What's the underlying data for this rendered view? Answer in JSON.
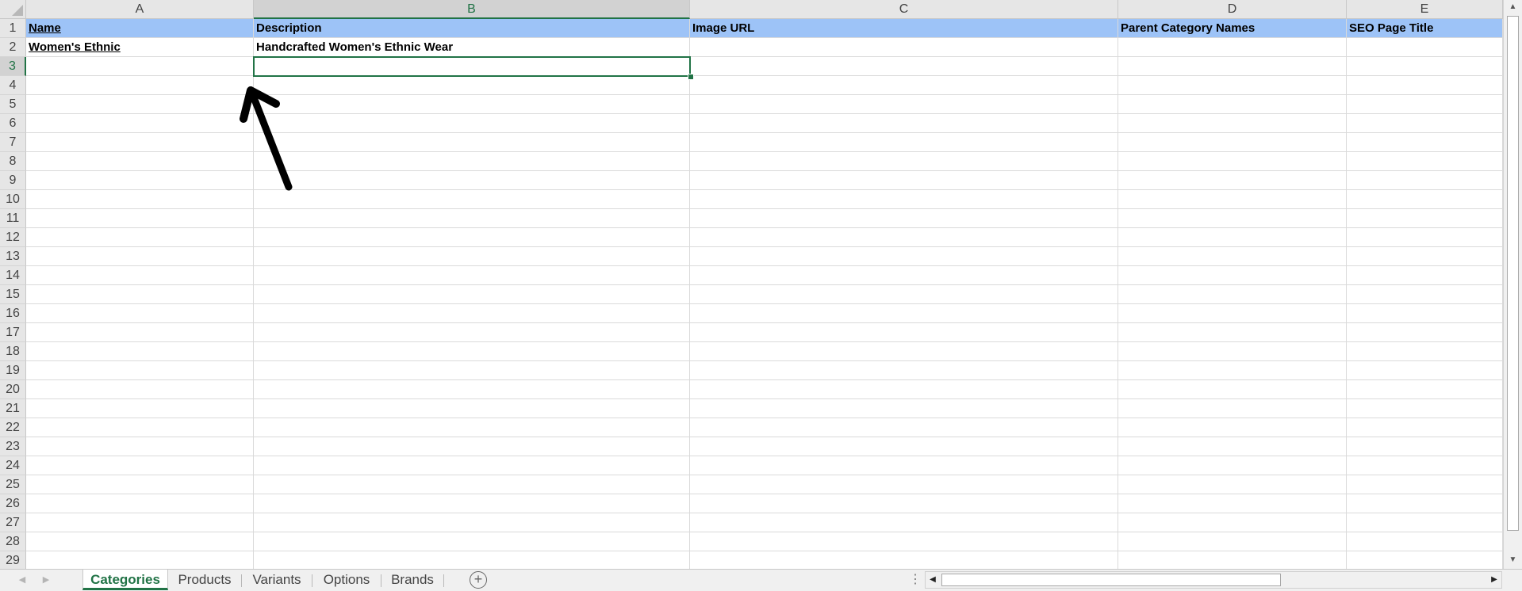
{
  "columns": [
    "A",
    "B",
    "C",
    "D",
    "E"
  ],
  "selected_column": "B",
  "selected_row": "3",
  "row_numbers": [
    "1",
    "2",
    "3",
    "4",
    "5",
    "6",
    "7",
    "8",
    "9",
    "10",
    "11",
    "12",
    "13",
    "14",
    "15",
    "16",
    "17",
    "18",
    "19",
    "20",
    "21",
    "22",
    "23",
    "24",
    "25",
    "26",
    "27",
    "28",
    "29"
  ],
  "headers": [
    "Name",
    "Description",
    "Image URL",
    "Parent Category Names",
    "SEO Page Title"
  ],
  "rows": [
    [
      "Women's Ethnic",
      "Handcrafted Women's Ethnic Wear",
      "",
      "",
      ""
    ]
  ],
  "sheet_tabs": [
    "Categories",
    "Products",
    "Variants",
    "Options",
    "Brands"
  ],
  "active_sheet": "Categories",
  "colors": {
    "header_fill": "#9dc3f7",
    "accent": "#217346",
    "annotation_arrow": "#000000"
  },
  "icons": {
    "add_sheet": "plus-circle-icon",
    "scroll_left": "triangle-left-icon",
    "scroll_right": "triangle-right-icon",
    "scroll_up": "triangle-up-icon",
    "scroll_down": "triangle-down-icon"
  }
}
